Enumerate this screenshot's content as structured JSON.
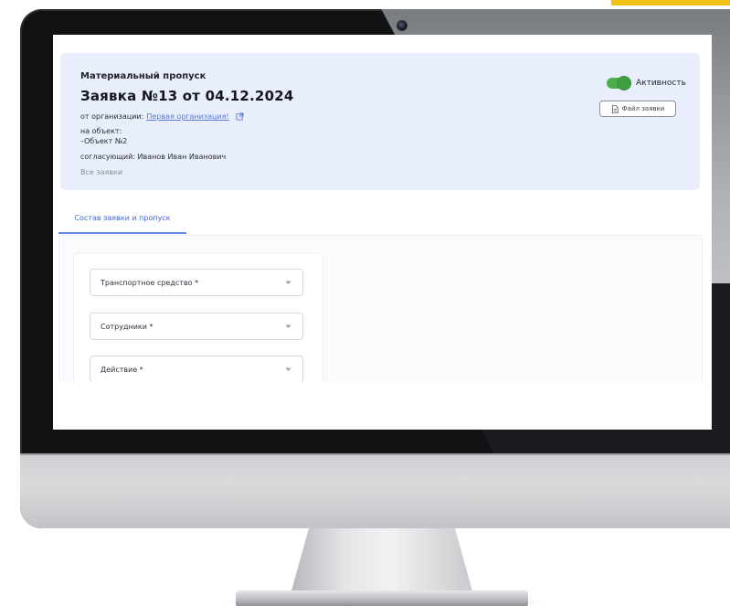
{
  "header": {
    "label": "Материальный пропуск",
    "title": "Заявка №13 от 04.12.2024",
    "org_prefix": "от организации:",
    "org_link": "Первая организация!",
    "object_label": "на объект:",
    "object_value": "–Объект №2",
    "approver": "согласующий: Иванов Иван Иванович",
    "all_requests": "Все заявки"
  },
  "activity": {
    "label": "Активность",
    "enabled": true
  },
  "file_button": {
    "label": "Файл заявки"
  },
  "tabs": [
    {
      "label": "Состав заявки и пропуск",
      "active": true
    }
  ],
  "form": {
    "fields": [
      {
        "placeholder": "Транспортное средство *"
      },
      {
        "placeholder": "Сотрудники *"
      },
      {
        "placeholder": "Действие *"
      }
    ]
  },
  "colors": {
    "accent": "#f2c012",
    "header_bg": "#e9eefc",
    "link": "#5a7bd6",
    "toggle_on": "#4cae4f",
    "tab_active": "#3e63d6"
  }
}
